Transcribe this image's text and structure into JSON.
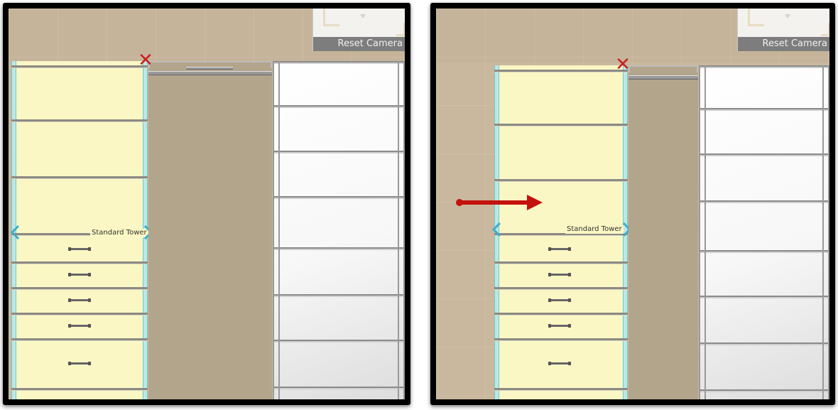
{
  "panels": [
    {
      "camera": {
        "reset_label": "Reset Camera"
      },
      "tower": {
        "label": "Standard Tower"
      },
      "icons": {
        "delete": "close-x-icon",
        "resize_left": "chevron-left-icon",
        "resize_right": "chevron-right-icon"
      }
    },
    {
      "camera": {
        "reset_label": "Reset Camera"
      },
      "tower": {
        "label": "Standard Tower"
      },
      "icons": {
        "delete": "close-x-icon",
        "resize_left": "chevron-left-icon",
        "resize_right": "chevron-right-icon",
        "annotation": "red-arrow-icon"
      }
    }
  ],
  "colors": {
    "wall": "#c9b89e",
    "selected_tower": "#fbf7c4",
    "edge_highlight": "#bfe6e6",
    "delete_x": "#cc1f1f",
    "annotation_arrow": "#c4120d"
  }
}
